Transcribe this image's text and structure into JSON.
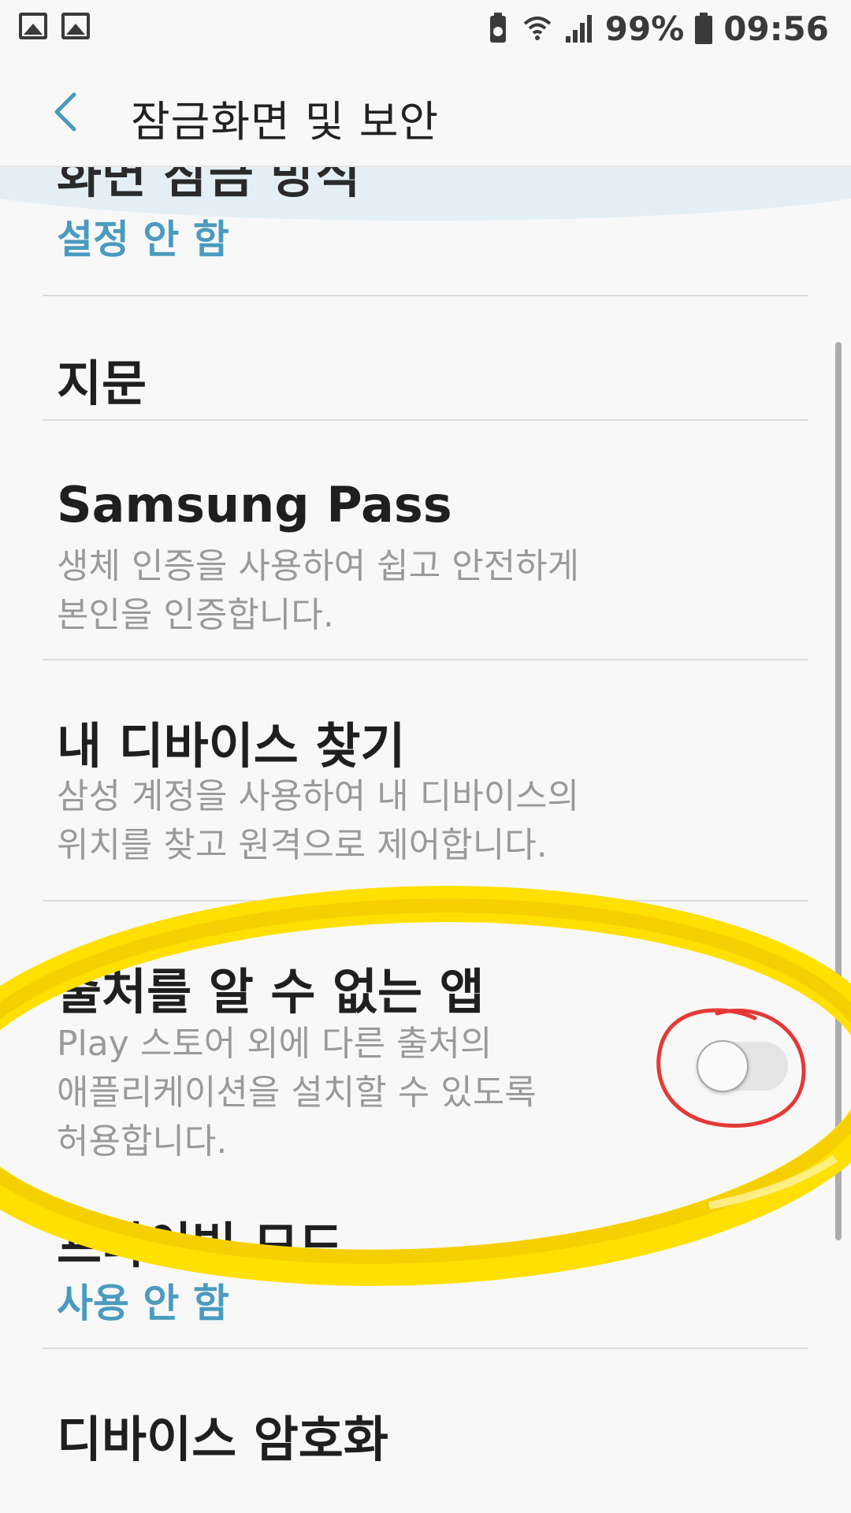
{
  "status_bar": {
    "battery_percent": "99%",
    "time": "09:56"
  },
  "app_bar": {
    "title": "잠금화면 및 보안"
  },
  "list": {
    "screen_lock_title": "화면 잠금 방식",
    "screen_lock_value": "설정 안 함",
    "fingerprint_title": "지문",
    "samsung_pass_title": "Samsung Pass",
    "samsung_pass_sub_1": "생체 인증을 사용하여 쉽고 안전하게",
    "samsung_pass_sub_2": "본인을 인증합니다.",
    "find_device_title": "내 디바이스 찾기",
    "find_device_sub_1": "삼성 계정을 사용하여 내 디바이스의",
    "find_device_sub_2": "위치를 찾고 원격으로 제어합니다.",
    "unknown_sources_title": "출처를 알 수 없는 앱",
    "unknown_sources_sub_1": "Play 스토어 외에 다른 출처의",
    "unknown_sources_sub_2": "애플리케이션을 설치할 수 있도록",
    "unknown_sources_sub_3": "허용합니다.",
    "unknown_sources_enabled": false,
    "private_mode_title": "프라이빗 모드",
    "private_mode_value": "사용 안 함",
    "encrypt_device_title": "디바이스 암호화"
  },
  "colors": {
    "accent": "#4a9bbf",
    "highlight_yellow": "#ffe000",
    "annotation_red": "#e53935"
  },
  "icons": {
    "back": "chevron-left-icon",
    "gallery": "image-icon",
    "battery": "battery-icon",
    "wifi": "wifi-icon",
    "signal": "signal-icon"
  }
}
